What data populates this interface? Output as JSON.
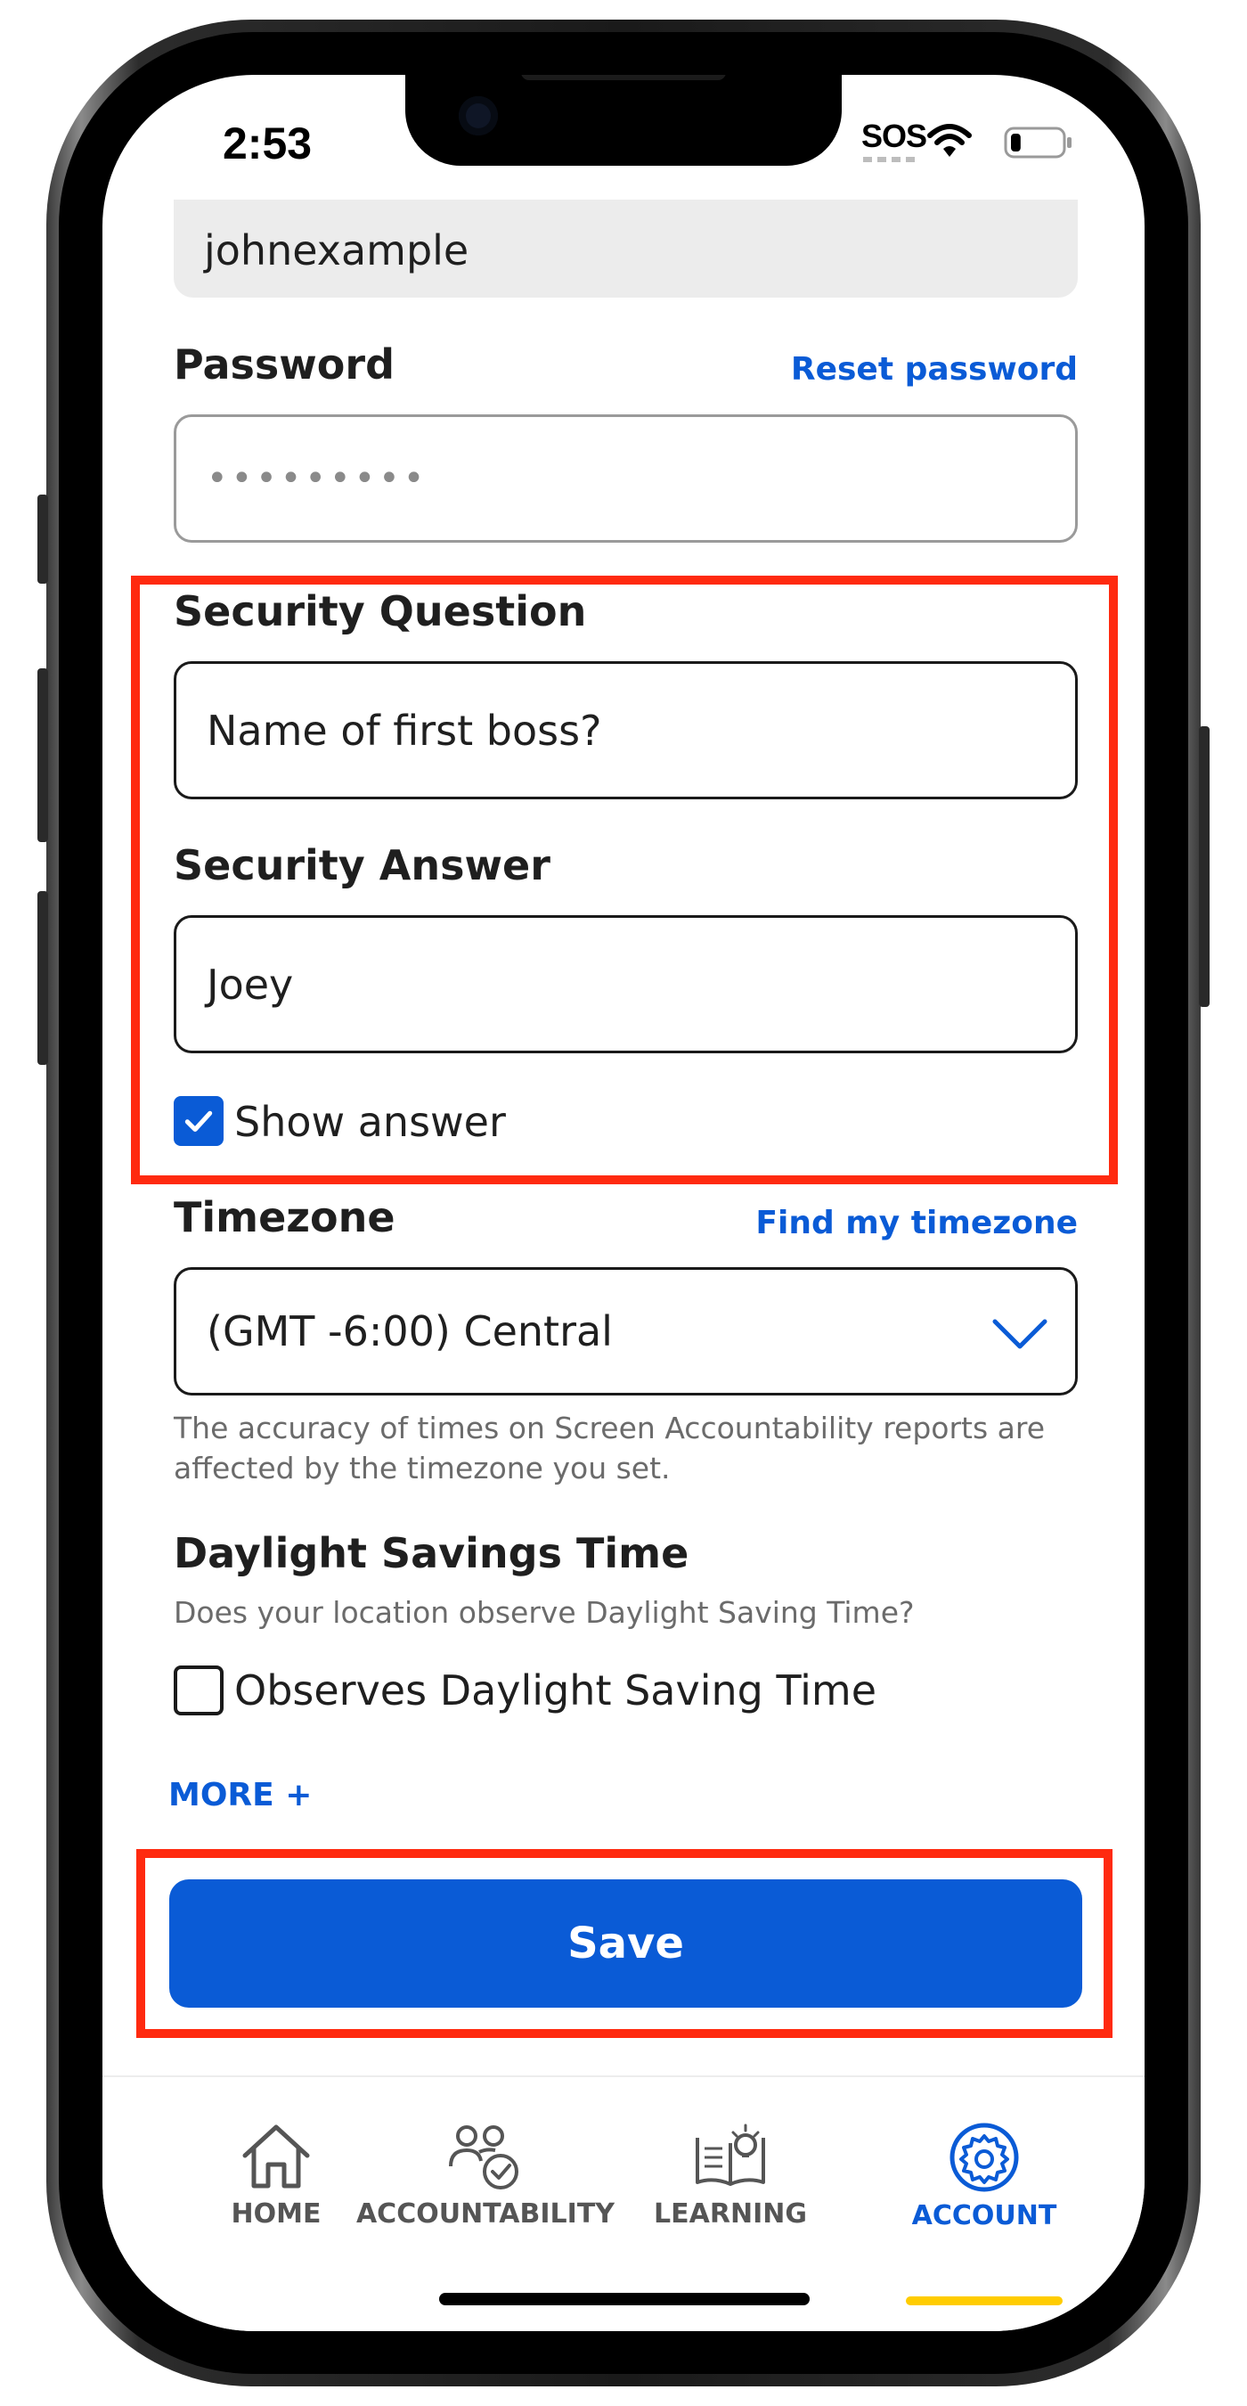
{
  "status_bar": {
    "time": "2:53",
    "carrier": "SOS",
    "battery_level": 0.2
  },
  "form": {
    "username_value": "johnexample",
    "password": {
      "label": "Password",
      "reset_link": "Reset password",
      "value": "•••••••••"
    },
    "security_question": {
      "label": "Security Question",
      "value": "Name of first boss?"
    },
    "security_answer": {
      "label": "Security Answer",
      "value": "Joey"
    },
    "show_answer": {
      "label": "Show answer",
      "checked": true
    },
    "timezone": {
      "label": "Timezone",
      "find_link": "Find my timezone",
      "value": "(GMT -6:00) Central",
      "help": "The accuracy of times on Screen Accountability reports are affected by the timezone you set."
    },
    "dst": {
      "label": "Daylight Savings Time",
      "help": "Does your location observe Daylight Saving Time?",
      "checkbox_label": "Observes Daylight Saving Time",
      "checked": false
    },
    "more_link": "MORE +",
    "save_label": "Save"
  },
  "bottom_nav": {
    "items": [
      {
        "label": "HOME",
        "icon": "home-icon",
        "active": false
      },
      {
        "label": "ACCOUNTABILITY",
        "icon": "people-check-icon",
        "active": false
      },
      {
        "label": "LEARNING",
        "icon": "book-lightbulb-icon",
        "active": false
      },
      {
        "label": "ACCOUNT",
        "icon": "gear-icon",
        "active": true
      }
    ]
  },
  "colors": {
    "accent": "#0a5bd6",
    "highlight": "#ff2a0f",
    "active_underline": "#ffcc00"
  }
}
